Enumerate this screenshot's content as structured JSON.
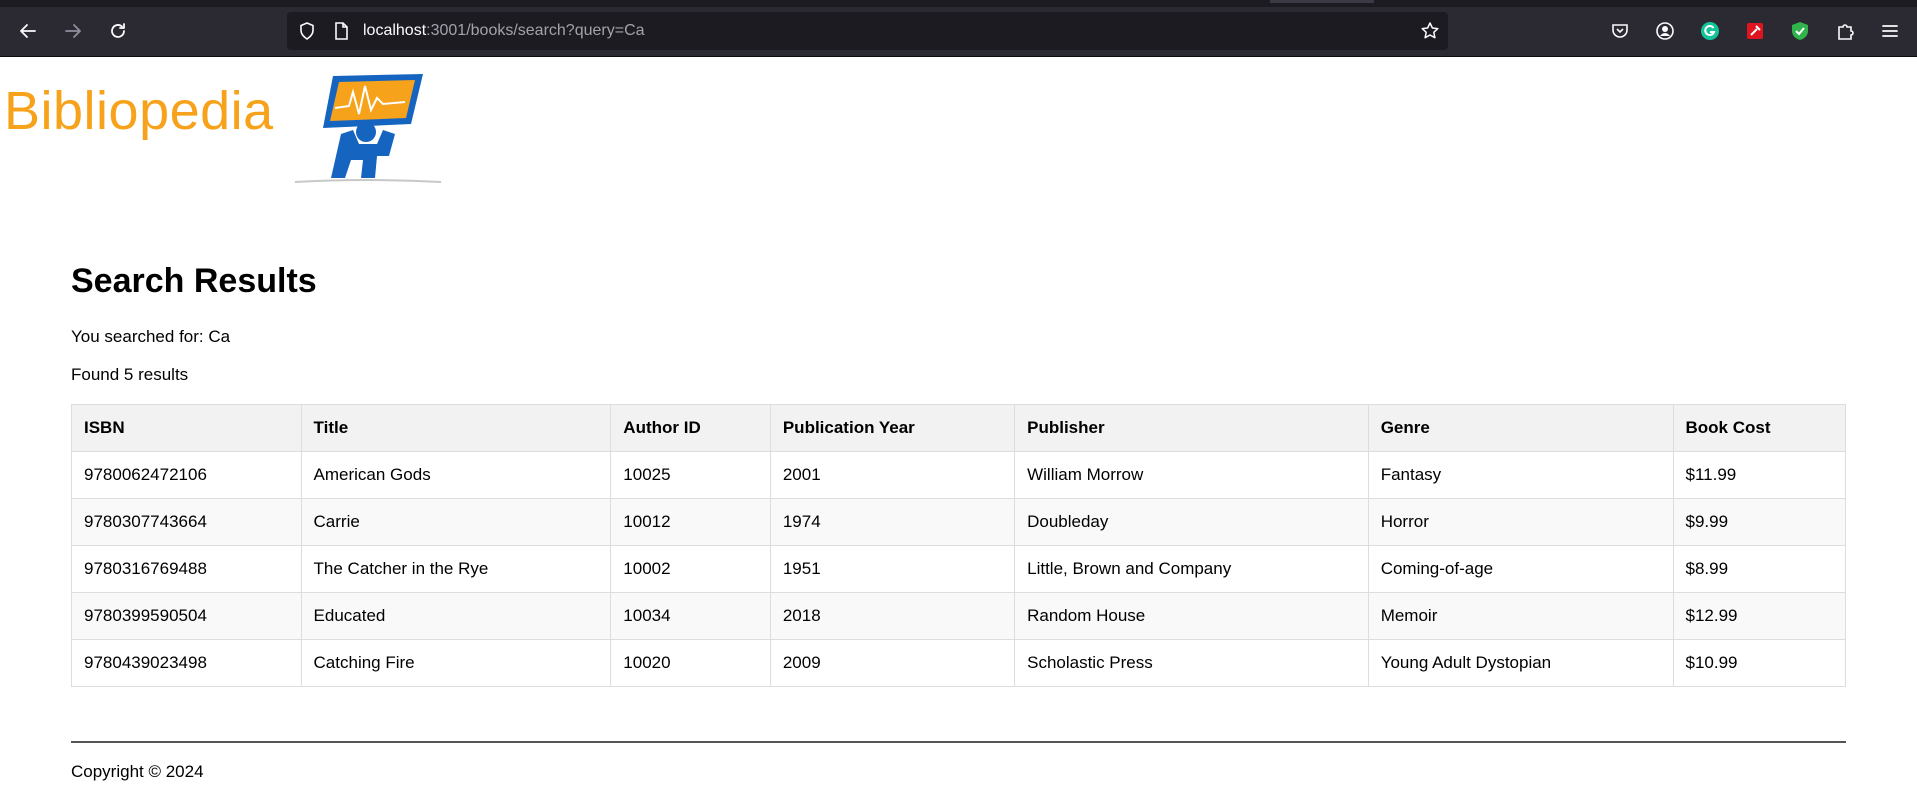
{
  "browser": {
    "url_host": "localhost",
    "url_path": ":3001/books/search?query=Ca"
  },
  "logo": {
    "text": "Bibliopedia"
  },
  "page": {
    "heading": "Search Results",
    "searched_for": "You searched for: Ca",
    "found": "Found 5 results"
  },
  "table": {
    "headers": [
      "ISBN",
      "Title",
      "Author ID",
      "Publication Year",
      "Publisher",
      "Genre",
      "Book Cost"
    ],
    "rows": [
      [
        "9780062472106",
        "American Gods",
        "10025",
        "2001",
        "William Morrow",
        "Fantasy",
        "$11.99"
      ],
      [
        "9780307743664",
        "Carrie",
        "10012",
        "1974",
        "Doubleday",
        "Horror",
        "$9.99"
      ],
      [
        "9780316769488",
        "The Catcher in the Rye",
        "10002",
        "1951",
        "Little, Brown and Company",
        "Coming-of-age",
        "$8.99"
      ],
      [
        "9780399590504",
        "Educated",
        "10034",
        "2018",
        "Random House",
        "Memoir",
        "$12.99"
      ],
      [
        "9780439023498",
        "Catching Fire",
        "10020",
        "2009",
        "Scholastic Press",
        "Young Adult Dystopian",
        "$10.99"
      ]
    ]
  },
  "footer": {
    "copyright": "Copyright © 2024"
  },
  "colors": {
    "logo_orange": "#f7a21b",
    "logo_blue": "#1565c0"
  }
}
